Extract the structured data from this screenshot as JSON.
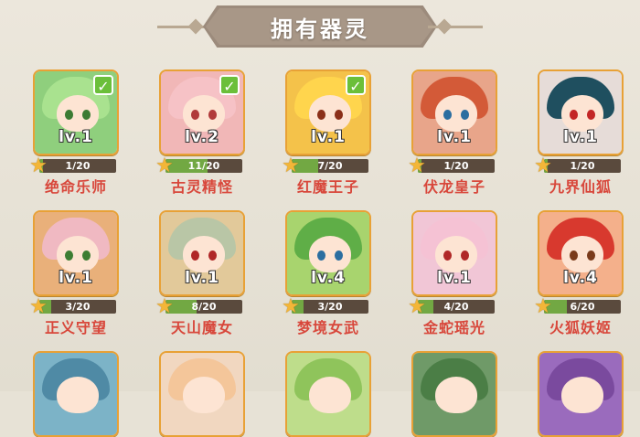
{
  "header": {
    "title": "拥有器灵"
  },
  "rows": [
    [
      {
        "name": "绝命乐师",
        "level": "lv.1",
        "progress": "1/20",
        "owned": true,
        "fill": 0.05,
        "palette": {
          "bg": "#8fcf7d",
          "hair": "#a9e28f",
          "eye": "#3c7b34"
        }
      },
      {
        "name": "古灵精怪",
        "level": "lv.2",
        "progress": "11/20",
        "owned": true,
        "fill": 0.55,
        "palette": {
          "bg": "#f1b7b7",
          "hair": "#f6c2c6",
          "eye": "#b13a3a"
        }
      },
      {
        "name": "红魔王子",
        "level": "lv.1",
        "progress": "7/20",
        "owned": true,
        "fill": 0.35,
        "palette": {
          "bg": "#f4c24a",
          "hair": "#ffd54d",
          "eye": "#8b2f18"
        }
      },
      {
        "name": "伏龙皇子",
        "level": "lv.1",
        "progress": "1/20",
        "owned": false,
        "fill": 0.05,
        "palette": {
          "bg": "#e8a58a",
          "hair": "#d35a38",
          "eye": "#2b6ea0"
        }
      },
      {
        "name": "九界仙狐",
        "level": "lv.1",
        "progress": "1/20",
        "owned": false,
        "fill": 0.05,
        "palette": {
          "bg": "#e6dcd8",
          "hair": "#1f4f5f",
          "eye": "#c32626"
        }
      }
    ],
    [
      {
        "name": "正义守望",
        "level": "lv.1",
        "progress": "3/20",
        "owned": false,
        "fill": 0.15,
        "palette": {
          "bg": "#e9b07a",
          "hair": "#f0b9c2",
          "eye": "#3d7d33"
        }
      },
      {
        "name": "天山魔女",
        "level": "lv.1",
        "progress": "8/20",
        "owned": false,
        "fill": 0.4,
        "palette": {
          "bg": "#e2c99a",
          "hair": "#b9c6a6",
          "eye": "#b02727"
        }
      },
      {
        "name": "梦境女武",
        "level": "lv.4",
        "progress": "3/20",
        "owned": false,
        "fill": 0.15,
        "palette": {
          "bg": "#a8d46e",
          "hair": "#5fae47",
          "eye": "#2b6ea0"
        }
      },
      {
        "name": "金蛇瑶光",
        "level": "lv.1",
        "progress": "4/20",
        "owned": false,
        "fill": 0.2,
        "palette": {
          "bg": "#f1c6d6",
          "hair": "#f5c2d4",
          "eye": "#b02727"
        }
      },
      {
        "name": "火狐妖姬",
        "level": "lv.4",
        "progress": "6/20",
        "owned": false,
        "fill": 0.3,
        "palette": {
          "bg": "#f4b08b",
          "hair": "#d8392e",
          "eye": "#7a3b1b"
        }
      }
    ],
    [
      {
        "palette": {
          "bg": "#7cb3c7",
          "hair": "#4f8aa5"
        }
      },
      {
        "palette": {
          "bg": "#f1d7c0",
          "hair": "#f4c69a"
        }
      },
      {
        "palette": {
          "bg": "#bedd8b",
          "hair": "#8fc45b"
        }
      },
      {
        "palette": {
          "bg": "#6f9a68",
          "hair": "#4b7e46"
        }
      },
      {
        "palette": {
          "bg": "#9a6bbd",
          "hair": "#7a4a9e"
        }
      }
    ]
  ]
}
